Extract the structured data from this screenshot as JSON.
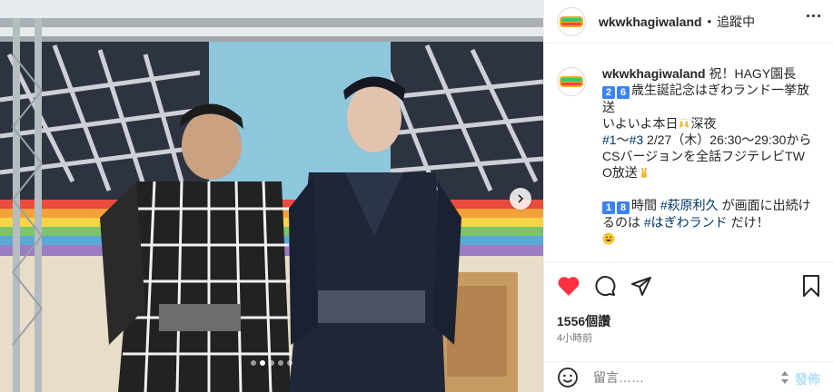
{
  "post": {
    "username": "wkwkhagiwaland",
    "follow_sep": "•",
    "follow_label": "追蹤中",
    "more_icon": "more-horizontal-icon",
    "caption": {
      "username": "wkwkhagiwaland",
      "line1_text": " 祝！HAGY園長",
      "badge_a": "2",
      "badge_b": "6",
      "line2_text": "歳生誕記念はぎわランド一挙放送",
      "line3_text": "いよいよ本日",
      "line3_emoji": "raised-hands-emoji",
      "line3_tail": "深夜",
      "tag1": "#1",
      "tilde": "～",
      "tag2": "#3",
      "line4_text": " 2/27（木）26:30～29:30から",
      "line5_text": "CSバージョンを全話フジテレビTWO放送",
      "line5_emoji": "victory-hand-emoji",
      "badge_c": "1",
      "badge_d": "8",
      "line6_a": "時間 ",
      "tag3": "#萩原利久",
      "line6_b": " が画面に出続けるのは ",
      "tag4": "#はぎわランド",
      "line6_c": " だけ！",
      "line7_emoji": "grinning-face-emoji"
    },
    "likes": "1556個讚",
    "time_ago": "4小時前",
    "comment_placeholder": "留言……",
    "post_label": "發佈"
  },
  "carousel": {
    "next_icon": "chevron-right-icon",
    "dots": 5,
    "active_dot": 2
  },
  "colors": {
    "like_red": "#ff3040",
    "link_blue": "#00376b",
    "post_disabled": "#b2dffc",
    "badge_blue": "#3b82f6"
  }
}
